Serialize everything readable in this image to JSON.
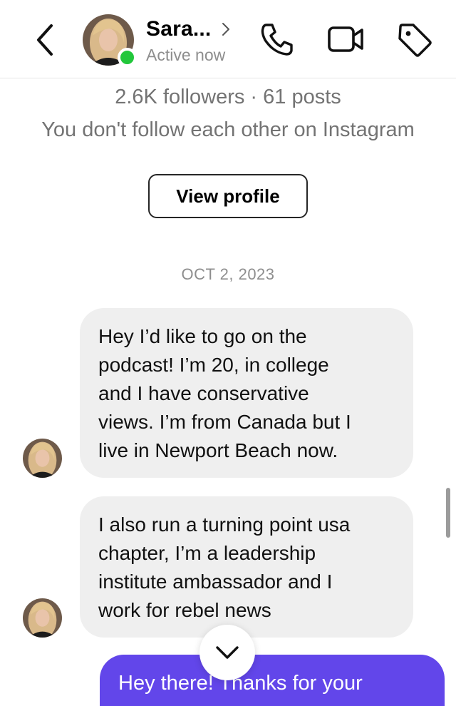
{
  "header": {
    "name": "Sara...",
    "status": "Active now",
    "icons": [
      "back-chevron-icon",
      "phone-icon",
      "video-camera-icon",
      "tag-icon"
    ],
    "online_color": "#22c73b"
  },
  "profile": {
    "followers": "2.6K followers · 61 posts",
    "follow_note": "You don't follow each other on Instagram",
    "view_profile_label": "View profile"
  },
  "thread": {
    "date": "OCT 2, 2023",
    "messages": [
      {
        "direction": "incoming",
        "lines": [
          "Hey I’d like to go on the",
          "podcast! I’m 20, in college",
          "and I have conservative",
          "views. I’m from Canada but I",
          "live in Newport Beach now."
        ]
      },
      {
        "direction": "incoming",
        "lines": [
          "I also run a turning point usa",
          "chapter, I’m a leadership",
          "institute ambassador and I",
          "work for rebel news"
        ]
      },
      {
        "direction": "outgoing",
        "lines": [
          "Hey there! Thanks for your"
        ]
      }
    ],
    "outgoing_color": "#6246ea",
    "incoming_color": "#efefef"
  }
}
